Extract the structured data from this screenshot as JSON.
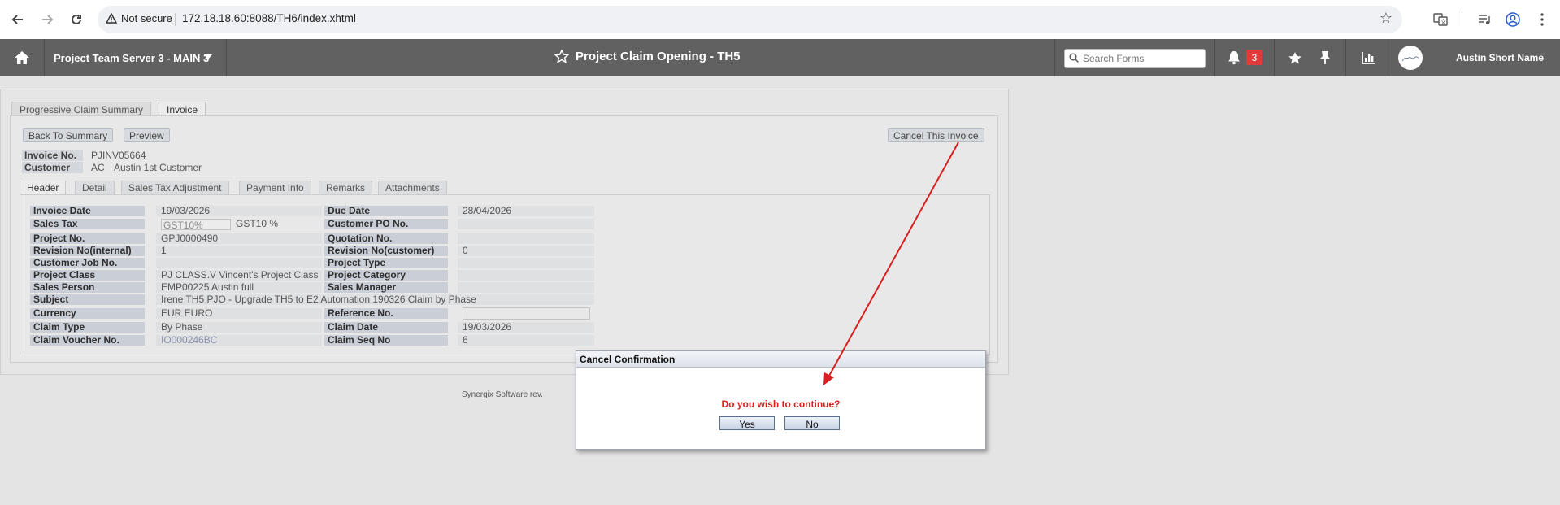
{
  "browser": {
    "security_label": "Not secure",
    "url": "172.18.18.60:8088/TH6/index.xhtml"
  },
  "header": {
    "server_label": "Project Team Server 3 - MAIN 3",
    "page_title": "Project Claim Opening - TH5",
    "search_placeholder": "Search Forms",
    "notification_count": "3",
    "user_name": "Austin Short Name"
  },
  "top_tabs": [
    "Progressive Claim Summary",
    "Invoice"
  ],
  "toolbar": {
    "back_label": "Back To Summary",
    "preview_label": "Preview",
    "cancel_invoice_label": "Cancel This Invoice"
  },
  "invoice_summary": {
    "invoice_no_label": "Invoice No.",
    "invoice_no_value": "PJINV05664",
    "customer_label": "Customer",
    "customer_code": "AC",
    "customer_name": "Austin 1st Customer"
  },
  "sub_tabs": [
    "Header",
    "Detail",
    "Sales Tax Adjustment",
    "Payment Info",
    "Remarks",
    "Attachments"
  ],
  "fields": {
    "invoice_date": {
      "label": "Invoice Date",
      "value": "19/03/2026"
    },
    "due_date": {
      "label": "Due Date",
      "value": "28/04/2026"
    },
    "sales_tax": {
      "label": "Sales Tax",
      "code": "GST10%",
      "value": "GST10 %"
    },
    "customer_po": {
      "label": "Customer PO No.",
      "value": ""
    },
    "project_no": {
      "label": "Project No.",
      "value": "GPJ0000490"
    },
    "quotation_no": {
      "label": "Quotation No.",
      "value": ""
    },
    "revision_internal": {
      "label": "Revision No(internal)",
      "value": "1"
    },
    "revision_customer": {
      "label": "Revision No(customer)",
      "value": "0"
    },
    "customer_job_no": {
      "label": "Customer Job No.",
      "value": ""
    },
    "project_type": {
      "label": "Project Type",
      "value": ""
    },
    "project_class": {
      "label": "Project Class",
      "value": "PJ CLASS.V Vincent's Project Class"
    },
    "project_category": {
      "label": "Project Category",
      "value": ""
    },
    "sales_person": {
      "label": "Sales Person",
      "value": "EMP00225 Austin full"
    },
    "sales_manager": {
      "label": "Sales Manager",
      "value": ""
    },
    "subject": {
      "label": "Subject",
      "value": "Irene TH5 PJO - Upgrade TH5 to E2 Automation 190326 Claim by Phase"
    },
    "currency": {
      "label": "Currency",
      "value": "EUR EURO"
    },
    "reference_no": {
      "label": "Reference No.",
      "value": ""
    },
    "claim_type": {
      "label": "Claim Type",
      "value": "By Phase"
    },
    "claim_date": {
      "label": "Claim Date",
      "value": "19/03/2026"
    },
    "claim_voucher_no": {
      "label": "Claim Voucher No.",
      "value": "IO000246BC"
    },
    "claim_seq_no": {
      "label": "Claim Seq No",
      "value": "6"
    }
  },
  "footer": {
    "text": "Synergix Software rev."
  },
  "dialog": {
    "title": "Cancel Confirmation",
    "message": "Do you wish to continue?",
    "yes_label": "Yes",
    "no_label": "No"
  },
  "colors": {
    "header_bg": "#616161",
    "annotation_arrow": "#d92020",
    "dialog_message": "#e02020",
    "badge": "#e03a3a"
  }
}
